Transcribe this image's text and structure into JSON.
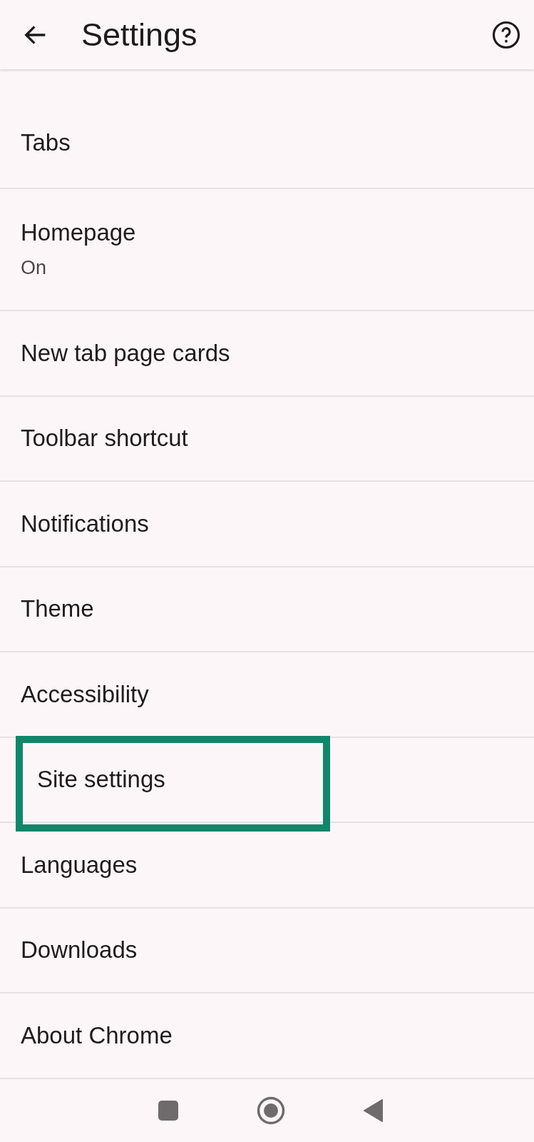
{
  "app_bar": {
    "title": "Settings"
  },
  "items": [
    {
      "title": "Tabs",
      "highlighted": false
    },
    {
      "title": "Homepage",
      "subtitle": "On",
      "highlighted": false
    },
    {
      "title": "New tab page cards",
      "highlighted": false
    },
    {
      "title": "Toolbar shortcut",
      "highlighted": false
    },
    {
      "title": "Notifications",
      "highlighted": false
    },
    {
      "title": "Theme",
      "highlighted": false
    },
    {
      "title": "Accessibility",
      "highlighted": false
    },
    {
      "title": "Site settings",
      "highlighted": true
    },
    {
      "title": "Languages",
      "highlighted": false
    },
    {
      "title": "Downloads",
      "highlighted": false
    },
    {
      "title": "About Chrome",
      "highlighted": false
    }
  ]
}
